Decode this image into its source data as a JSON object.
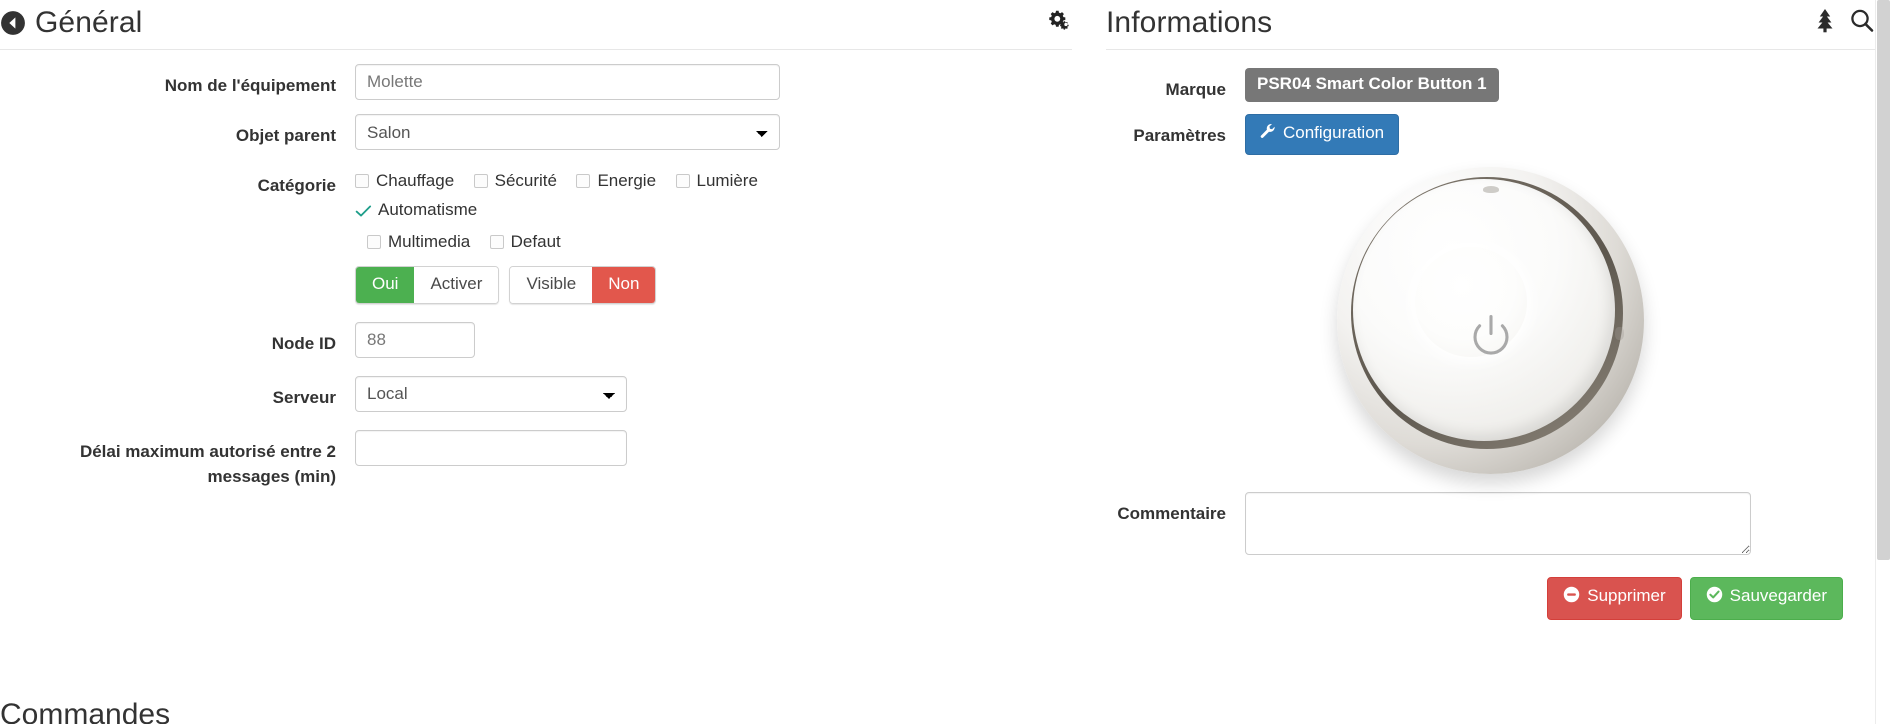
{
  "left_panel": {
    "title": "Général",
    "back_icon": "back-arrow-circle-icon",
    "gear_icon": "gears-icon",
    "fields": {
      "name_label": "Nom de l'équipement",
      "name_value": "Molette",
      "parent_label": "Objet parent",
      "parent_value": "Salon",
      "category_label": "Catégorie",
      "node_id_label": "Node ID",
      "node_id_value": "88",
      "server_label": "Serveur",
      "server_value": "Local",
      "delay_label": "Délai maximum autorisé entre 2 messages (min)",
      "delay_value": ""
    },
    "categories": [
      {
        "label": "Chauffage",
        "checked": false
      },
      {
        "label": "Sécurité",
        "checked": false
      },
      {
        "label": "Energie",
        "checked": false
      },
      {
        "label": "Lumière",
        "checked": false
      },
      {
        "label": "Automatisme",
        "checked": true
      },
      {
        "label": "Multimedia",
        "checked": false
      },
      {
        "label": "Defaut",
        "checked": false
      }
    ],
    "toggles": {
      "enable_on": "Oui",
      "enable_off": "Activer",
      "visible_on": "Visible",
      "visible_off": "Non"
    }
  },
  "right_panel": {
    "title": "Informations",
    "tree_icon": "tree-icon",
    "search_icon": "search-icon",
    "brand_label": "Marque",
    "brand_value": "PSR04 Smart Color Button 1",
    "params_label": "Paramètres",
    "config_button": "Configuration",
    "config_icon": "wrench-icon",
    "device_image_name": "smart-color-button-device-image",
    "comment_label": "Commentaire",
    "comment_value": "",
    "delete_button": "Supprimer",
    "delete_icon": "minus-circle-icon",
    "save_button": "Sauvegarder",
    "save_icon": "check-circle-icon"
  },
  "footer": {
    "commandes_heading": "Commandes"
  },
  "colors": {
    "green": "#4cb050",
    "red": "#e2574c",
    "blue": "#337ab7",
    "badge_gray": "#777777",
    "danger": "#d9534f",
    "success": "#5cb85c",
    "check_teal": "#1e9e8a"
  }
}
